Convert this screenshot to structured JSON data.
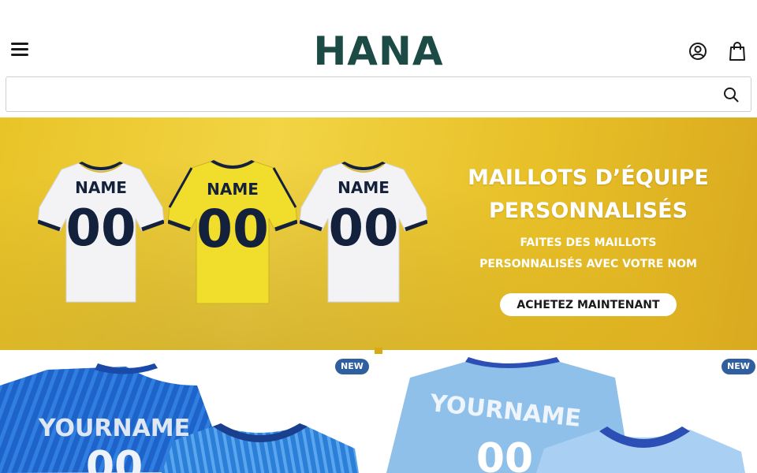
{
  "header": {
    "logo": "HANA",
    "menu_icon": "hamburger-menu-icon",
    "account_icon": "user-account-icon",
    "cart_icon": "shopping-bag-icon"
  },
  "search": {
    "placeholder": "",
    "value": "",
    "icon": "search-icon"
  },
  "hero": {
    "title_line1": "MAILLOTS D’ÉQUIPE",
    "title_line2": "PERSONNALISÉS",
    "subtitle_line1": "FAITES DES MAILLOTS",
    "subtitle_line2": "PERSONNALISÉS AVEC VOTRE NOM",
    "cta_label": "ACHETEZ MAINTENANT",
    "jerseys": [
      {
        "name": "NAME",
        "number": "00",
        "color": "white"
      },
      {
        "name": "NAME",
        "number": "00",
        "color": "yellow"
      },
      {
        "name": "NAME",
        "number": "00",
        "color": "white"
      }
    ],
    "background_color": "#ecc82e",
    "carousel_active": 1
  },
  "products": [
    {
      "badge": "NEW",
      "jersey_text": "YOURNAME",
      "jersey_number": "00",
      "color": "#1e63c9"
    },
    {
      "badge": "NEW",
      "jersey_text": "YOURNAME",
      "jersey_number": "00",
      "color": "#8fc0ea"
    }
  ],
  "colors": {
    "brand": "#1c4a45",
    "badge": "#2f5f9e",
    "navy": "#14213d"
  }
}
